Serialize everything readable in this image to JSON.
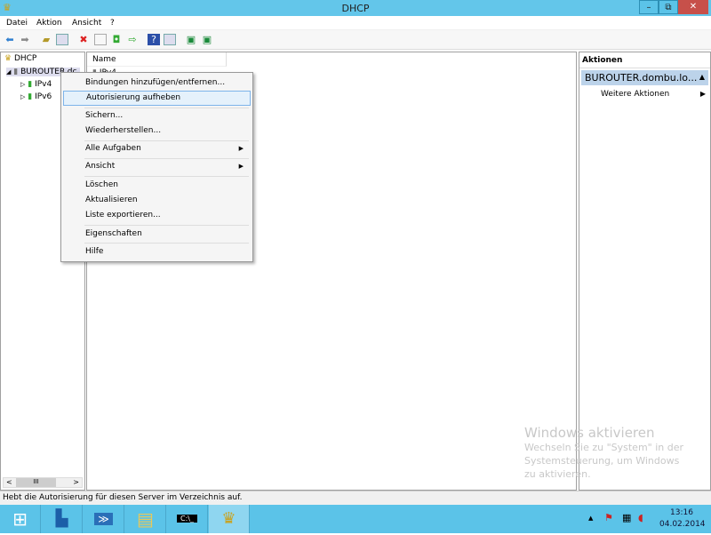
{
  "window": {
    "title": "DHCP",
    "min": "–",
    "restore": "⧉",
    "close": "✕",
    "close_color": "#c7504a"
  },
  "menu": [
    "Datei",
    "Aktion",
    "Ansicht",
    "?"
  ],
  "toolbar": [
    "back-icon",
    "forward-icon",
    "up-folder-icon",
    "show-hide-tree-icon",
    "delete-icon",
    "properties-icon",
    "refresh-icon",
    "export-icon",
    "help-icon",
    "show-hide-action-icon",
    "server-icon",
    "servers-icon"
  ],
  "tree": {
    "root": "DHCP",
    "server": "BUROUTER.dc",
    "ipv4": "IPv4",
    "ipv6": "IPv6"
  },
  "list": {
    "header": "Name",
    "row": "IPv4"
  },
  "context_menu": {
    "items": [
      "Bindungen hinzufügen/entfernen...",
      "Autorisierung aufheben",
      "Sichern...",
      "Wiederherstellen...",
      "Alle Aufgaben",
      "Ansicht",
      "Löschen",
      "Aktualisieren",
      "Liste exportieren...",
      "Eigenschaften",
      "Hilfe"
    ],
    "highlighted": "Autorisierung aufheben"
  },
  "actions": {
    "header": "Aktionen",
    "section": "BUROUTER.dombu.lo...",
    "item": "Weitere Aktionen"
  },
  "watermark": {
    "title": "Windows aktivieren",
    "text": "Wechseln Sie zu \"System\" in der Systemsteuerung, um Windows zu aktivieren."
  },
  "status": "Hebt die Autorisierung für diesen Server im Verzeichnis auf.",
  "scrollbar": {
    "left": "<",
    "thumb": "III",
    "right": ">"
  },
  "taskbar": {
    "apps": [
      "start",
      "server-manager",
      "powershell",
      "explorer",
      "cmd",
      "dhcp"
    ],
    "time": "13:16",
    "date": "04.02.2014",
    "color": "#5bc3e8"
  }
}
